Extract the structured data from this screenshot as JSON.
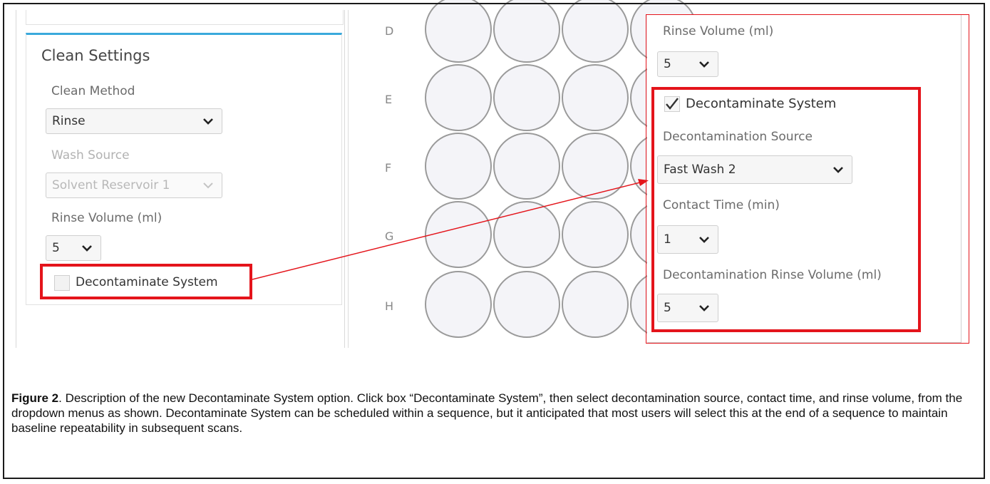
{
  "left_panel": {
    "title": "Clean Settings",
    "clean_method_label": "Clean Method",
    "clean_method_value": "Rinse",
    "wash_source_label": "Wash Source",
    "wash_source_value": "Solvent Reservoir 1",
    "rinse_volume_label": "Rinse Volume (ml)",
    "rinse_volume_value": "5",
    "decontaminate_label": "Decontaminate System",
    "decontaminate_checked": false
  },
  "plate": {
    "rows": [
      "D",
      "E",
      "F",
      "G",
      "H"
    ]
  },
  "right_panel": {
    "rinse_volume_label": "Rinse Volume (ml)",
    "rinse_volume_value": "5",
    "decontaminate_label": "Decontaminate System",
    "decontaminate_checked": true,
    "decon_source_label": "Decontamination Source",
    "decon_source_value": "Fast Wash 2",
    "contact_time_label": "Contact Time (min)",
    "contact_time_value": "1",
    "decon_rinse_label": "Decontamination Rinse Volume (ml)",
    "decon_rinse_value": "5"
  },
  "caption": {
    "label": "Figure 2",
    "text": ". Description of the new Decontaminate System option. Click box “Decontaminate System”, then select decontamination source, contact time, and rinse volume, from the dropdown menus as shown. Decontaminate System can be scheduled within a sequence, but it anticipated that most users will select this at the end of a sequence to maintain baseline repeatability in subsequent scans."
  },
  "colors": {
    "highlight": "#e4141b",
    "accent": "#3aa9dc"
  }
}
